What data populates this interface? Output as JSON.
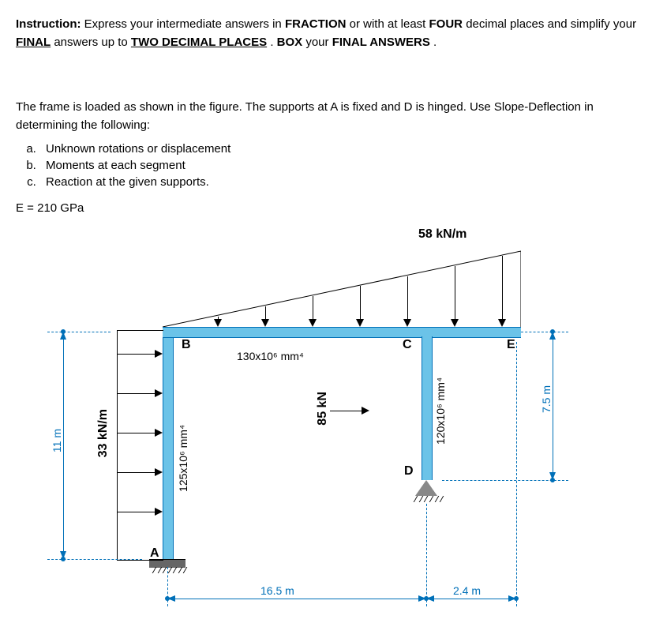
{
  "instruction": {
    "prefix": "Instruction:",
    "part1": " Express your intermediate answers in ",
    "kw1": "FRACTION",
    "part2": " or with at least ",
    "kw2": "FOUR",
    "part3": " decimal places and simplify your ",
    "kw3": "FINAL",
    "part4": " answers up to ",
    "kw4": "TWO DECIMAL PLACES",
    "part5": ". ",
    "kw5": "BOX",
    "part6": " your ",
    "kw6": "FINAL ANSWERS",
    "part7": "."
  },
  "problem_intro": "The frame is loaded as shown in the figure. The supports at A is fixed and D is hinged. Use Slope-Deflection in determining the following:",
  "tasks": {
    "a": "Unknown rotations or displacement",
    "b": "Moments at each segment",
    "c": "Reaction at the given supports."
  },
  "modulus": "E = 210 GPa",
  "diagram": {
    "nodes": {
      "A": "A",
      "B": "B",
      "C": "C",
      "D": "D",
      "E": "E"
    },
    "loads": {
      "tri_dist": "58 kN/m",
      "udl_left": "33 kN/m",
      "point": "85 kN"
    },
    "inertia": {
      "bc": "130x10⁶ mm⁴",
      "ab": "125x10⁶ mm⁴",
      "cd": "120x10⁶ mm⁴"
    },
    "dims": {
      "h_left": "11 m",
      "h_right": "7.5 m",
      "span_bd": "16.5 m",
      "span_de": "2.4 m"
    }
  },
  "chart_data": {
    "type": "diagram",
    "structure": "portal-frame-with-cantilever",
    "E_GPa": 210,
    "members": [
      {
        "name": "AB",
        "from": "A",
        "to": "B",
        "length_m": 11.0,
        "I_mm4": 125000000
      },
      {
        "name": "BC",
        "from": "B",
        "to": "C",
        "length_m": 16.5,
        "I_mm4": 130000000
      },
      {
        "name": "CD",
        "from": "C",
        "to": "D",
        "length_m": 7.5,
        "I_mm4": 120000000
      },
      {
        "name": "CE",
        "from": "C",
        "to": "E",
        "length_m": 2.4,
        "I_mm4": 130000000
      }
    ],
    "supports": {
      "A": "fixed",
      "D": "hinged"
    },
    "loads": [
      {
        "type": "udl",
        "member": "AB",
        "w_kN_per_m": 33,
        "direction": "horizontal_right"
      },
      {
        "type": "triangular",
        "span": "B-to-E",
        "w_max_kN_per_m": 58,
        "max_at": "E",
        "direction": "vertical_down"
      },
      {
        "type": "point",
        "member": "BC",
        "P_kN": 85,
        "direction": "horizontal_right",
        "location": "mid-height-arrow-on-BC"
      }
    ],
    "geometry_note": "Column AB height 11 m; beam B-C-E total horizontal 16.5+2.4=18.9 m; column CD height 7.5 m with D below C."
  }
}
